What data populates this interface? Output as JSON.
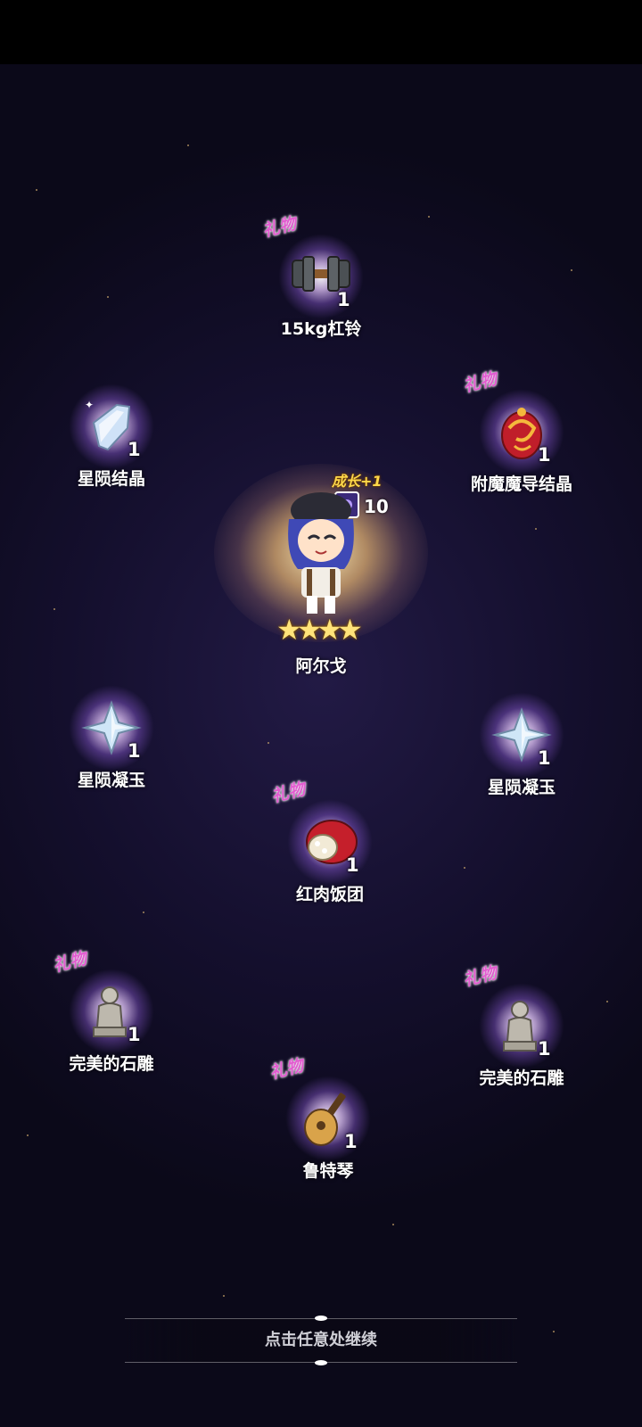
{
  "items": [
    {
      "id": "barbell",
      "name": "15kg杠铃",
      "count": "1",
      "gift": "礼物"
    },
    {
      "id": "crystal-left",
      "name": "星陨结晶",
      "count": "1",
      "gift": ""
    },
    {
      "id": "enchant-crystal",
      "name": "附魔魔导结晶",
      "count": "1",
      "gift": "礼物"
    },
    {
      "id": "jade-left",
      "name": "星陨凝玉",
      "count": "1",
      "gift": ""
    },
    {
      "id": "jade-right",
      "name": "星陨凝玉",
      "count": "1",
      "gift": ""
    },
    {
      "id": "rice-ball",
      "name": "红肉饭团",
      "count": "1",
      "gift": "礼物"
    },
    {
      "id": "statue-left",
      "name": "完美的石雕",
      "count": "1",
      "gift": "礼物"
    },
    {
      "id": "statue-right",
      "name": "完美的石雕",
      "count": "1",
      "gift": "礼物"
    },
    {
      "id": "lute",
      "name": "鲁特琴",
      "count": "1",
      "gift": "礼物"
    }
  ],
  "hero": {
    "name": "阿尔戈",
    "growth_label": "成长+1",
    "card_count": "10",
    "stars": 4
  },
  "continue_label": "点击任意处继续",
  "colors": {
    "background": "#140f2d",
    "gift_tag": "#e25cd0",
    "star": "#ffe37a"
  }
}
